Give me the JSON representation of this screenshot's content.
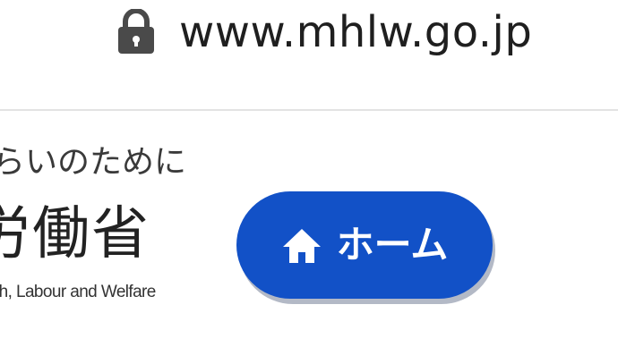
{
  "browser": {
    "url": "www.mhlw.go.jp",
    "lock_icon": "lock-icon"
  },
  "header": {
    "tagline": "らいのために",
    "ministry_name_jp": "労働省",
    "ministry_name_en": "th, Labour and Welfare"
  },
  "home_button": {
    "label": "ホーム",
    "icon": "home-icon",
    "background_color": "#1251c7",
    "text_color": "#ffffff"
  }
}
